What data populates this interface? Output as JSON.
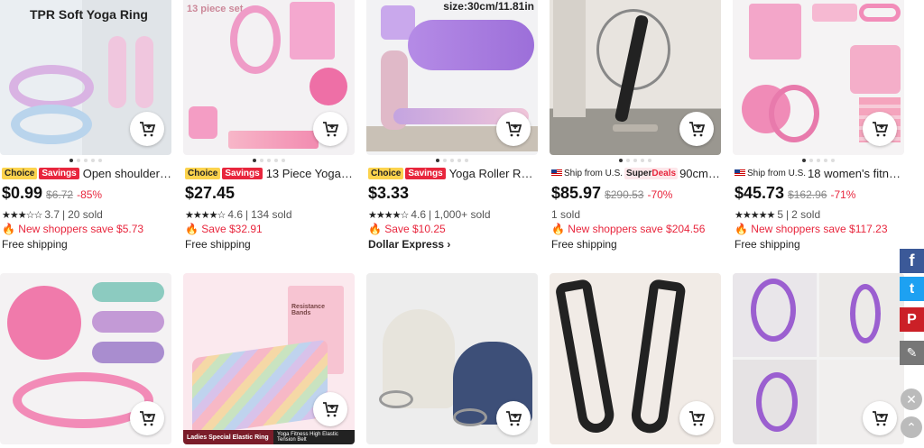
{
  "products_row1": [
    {
      "image_caption": "TPR Soft Yoga Ring",
      "badges": {
        "choice": "Choice",
        "savings": "Savings"
      },
      "title": "Open shoulder a...",
      "price": "$0.99",
      "old_price": "$6.72",
      "discount": "-85%",
      "rating": "3.7",
      "sold": "20 sold",
      "save_text": "New shoppers save $5.73",
      "shipping": "Free shipping"
    },
    {
      "image_caption": "13 piece set",
      "badges": {
        "choice": "Choice",
        "savings": "Savings"
      },
      "title": "13 Piece Yoga Cir...",
      "price": "$27.45",
      "rating": "4.6",
      "sold": "134 sold",
      "save_text": "Save $32.91",
      "shipping": "Free shipping"
    },
    {
      "image_caption": "size:30cm/11.81in",
      "badges": {
        "choice": "Choice",
        "savings": "Savings"
      },
      "title": "Yoga Roller Roun...",
      "price": "$3.33",
      "rating": "4.6",
      "sold": "1,000+ sold",
      "save_text": "Save $10.25",
      "shipping": "Dollar Express"
    },
    {
      "ship_from": "Ship from U.S.",
      "superdeals": {
        "a": "Super",
        "b": "Deals"
      },
      "title": "90cm A...",
      "price": "$85.97",
      "old_price": "$290.53",
      "discount": "-70%",
      "sold": "1 sold",
      "save_text": "New shoppers save $204.56",
      "shipping": "Free shipping"
    },
    {
      "ship_from": "Ship from U.S.",
      "title": "18 women's fitnes...",
      "price": "$45.73",
      "old_price": "$162.96",
      "discount": "-71%",
      "rating": "5",
      "sold": "2 sold",
      "save_text": "New shoppers save $117.23",
      "shipping": "Free shipping"
    }
  ],
  "products_row2": [
    {
      "image_caption": ""
    },
    {
      "image_caption": "Resistance Bands",
      "caption_left": "Ladies Special Elastic Ring",
      "caption_right": "Yoga Fitness High Elastic Tension Belt"
    },
    {
      "image_caption": ""
    },
    {
      "image_caption": ""
    },
    {
      "image_caption": ""
    }
  ],
  "social": {
    "facebook": "f",
    "twitter": "t",
    "pinterest": "P",
    "edit": "✎",
    "close": "✕",
    "up": "⌃"
  },
  "icons": {
    "cart": "add-to-cart-icon",
    "fire": "fire-icon",
    "chevron": "chevron-right-icon"
  },
  "colors": {
    "accent_red": "#e8263d",
    "choice_yellow": "#fcd34d",
    "facebook": "#3b5998",
    "twitter": "#1da1f2",
    "pinterest": "#cb2027"
  }
}
